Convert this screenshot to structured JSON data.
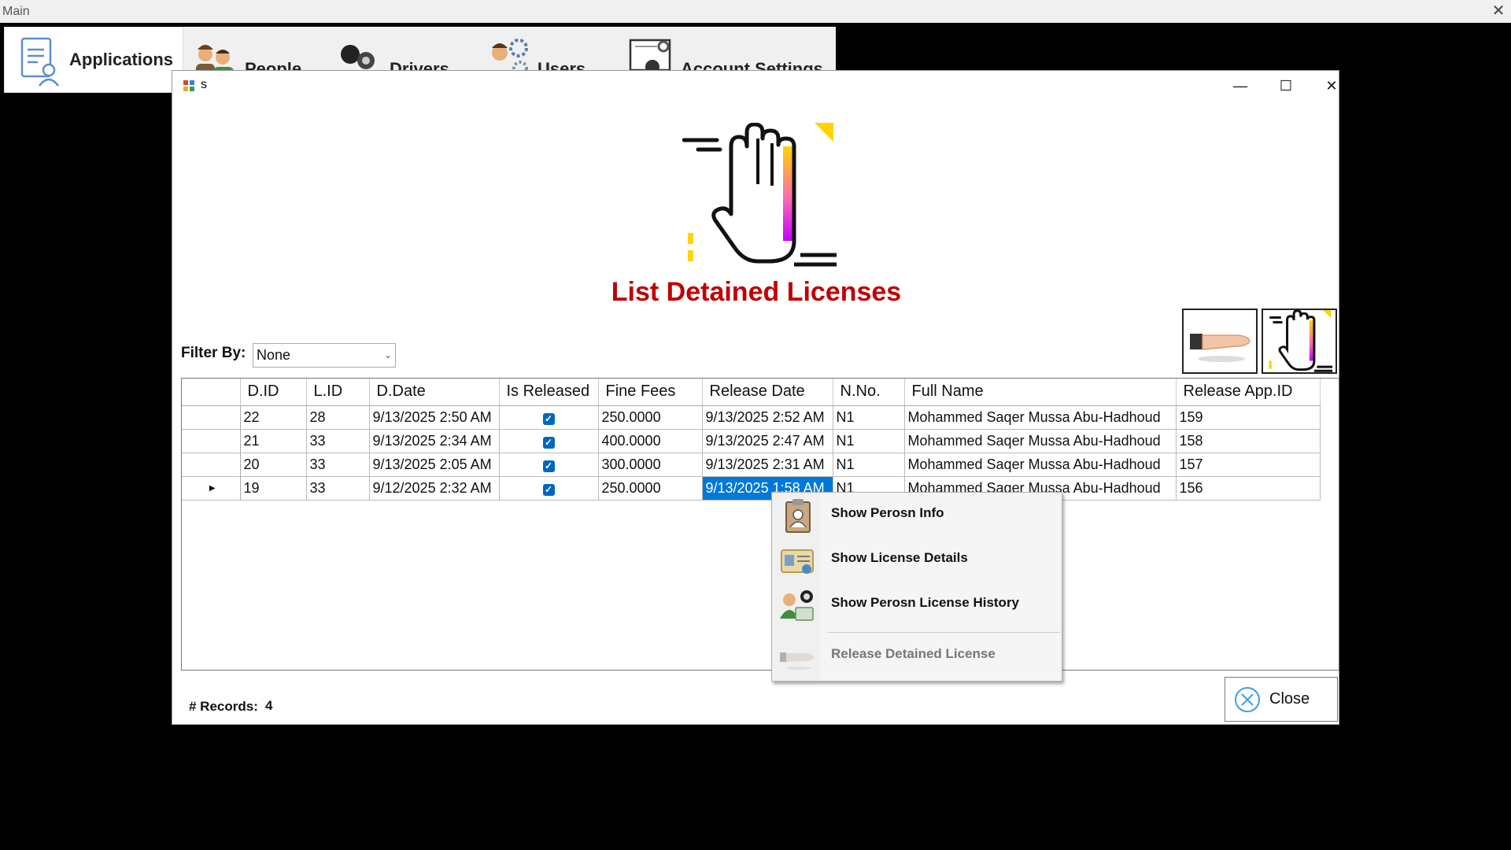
{
  "main_window": {
    "title": "Main"
  },
  "menu": {
    "items": [
      {
        "label": "Applications",
        "icon": "applications-icon"
      },
      {
        "label": "People",
        "icon": "people-icon"
      },
      {
        "label": "Drivers",
        "icon": "drivers-icon"
      },
      {
        "label": "Users",
        "icon": "users-icon"
      },
      {
        "label": "Account Settings",
        "icon": "account-settings-icon"
      }
    ]
  },
  "dialog": {
    "title": "s",
    "page_title": "List Detained Licenses",
    "filter_label": "Filter By:",
    "filter_value": "None",
    "records_label": "# Records:",
    "records_count": "4",
    "close_label": "Close"
  },
  "grid": {
    "columns": [
      "D.ID",
      "L.ID",
      "D.Date",
      "Is Released",
      "Fine Fees",
      "Release Date",
      "N.No.",
      "Full Name",
      "Release App.ID"
    ],
    "rows": [
      [
        "22",
        "28",
        "9/13/2025 2:50 AM",
        "true",
        "250.0000",
        "9/13/2025 2:52 AM",
        "N1",
        "Mohammed Saqer Mussa Abu-Hadhoud",
        "159"
      ],
      [
        "21",
        "33",
        "9/13/2025 2:34 AM",
        "true",
        "400.0000",
        "9/13/2025 2:47 AM",
        "N1",
        "Mohammed Saqer Mussa Abu-Hadhoud",
        "158"
      ],
      [
        "20",
        "33",
        "9/13/2025 2:05 AM",
        "true",
        "300.0000",
        "9/13/2025 2:31 AM",
        "N1",
        "Mohammed Saqer Mussa Abu-Hadhoud",
        "157"
      ],
      [
        "19",
        "33",
        "9/12/2025 2:32 AM",
        "true",
        "250.0000",
        "9/13/2025 1:58 AM",
        "N1",
        "Mohammed Saqer Mussa Abu-Hadhoud",
        "156"
      ]
    ],
    "current_row_index": 3
  },
  "context_menu": {
    "items": [
      {
        "label": "Show Perosn Info",
        "icon": "person-card-icon",
        "enabled": true
      },
      {
        "label": "Show License Details",
        "icon": "license-details-icon",
        "enabled": true
      },
      {
        "label": "Show Perosn License History",
        "icon": "license-history-icon",
        "enabled": true
      },
      {
        "label": "Release Detained License",
        "icon": "release-hand-icon",
        "enabled": false
      }
    ]
  },
  "colors": {
    "title_red": "#c00000",
    "selection_blue": "#0078d7",
    "checkbox_blue": "#0067c0"
  }
}
